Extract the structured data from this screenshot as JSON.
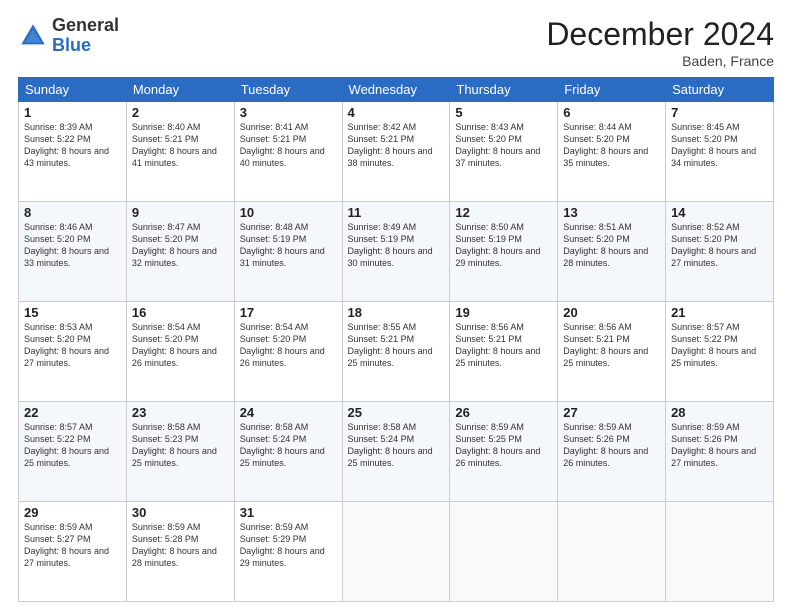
{
  "logo": {
    "general": "General",
    "blue": "Blue"
  },
  "header": {
    "month": "December 2024",
    "location": "Baden, France"
  },
  "weekdays": [
    "Sunday",
    "Monday",
    "Tuesday",
    "Wednesday",
    "Thursday",
    "Friday",
    "Saturday"
  ],
  "weeks": [
    [
      {
        "day": "1",
        "sunrise": "8:39 AM",
        "sunset": "5:22 PM",
        "daylight": "8 hours and 43 minutes."
      },
      {
        "day": "2",
        "sunrise": "8:40 AM",
        "sunset": "5:21 PM",
        "daylight": "8 hours and 41 minutes."
      },
      {
        "day": "3",
        "sunrise": "8:41 AM",
        "sunset": "5:21 PM",
        "daylight": "8 hours and 40 minutes."
      },
      {
        "day": "4",
        "sunrise": "8:42 AM",
        "sunset": "5:21 PM",
        "daylight": "8 hours and 38 minutes."
      },
      {
        "day": "5",
        "sunrise": "8:43 AM",
        "sunset": "5:20 PM",
        "daylight": "8 hours and 37 minutes."
      },
      {
        "day": "6",
        "sunrise": "8:44 AM",
        "sunset": "5:20 PM",
        "daylight": "8 hours and 35 minutes."
      },
      {
        "day": "7",
        "sunrise": "8:45 AM",
        "sunset": "5:20 PM",
        "daylight": "8 hours and 34 minutes."
      }
    ],
    [
      {
        "day": "8",
        "sunrise": "8:46 AM",
        "sunset": "5:20 PM",
        "daylight": "8 hours and 33 minutes."
      },
      {
        "day": "9",
        "sunrise": "8:47 AM",
        "sunset": "5:20 PM",
        "daylight": "8 hours and 32 minutes."
      },
      {
        "day": "10",
        "sunrise": "8:48 AM",
        "sunset": "5:19 PM",
        "daylight": "8 hours and 31 minutes."
      },
      {
        "day": "11",
        "sunrise": "8:49 AM",
        "sunset": "5:19 PM",
        "daylight": "8 hours and 30 minutes."
      },
      {
        "day": "12",
        "sunrise": "8:50 AM",
        "sunset": "5:19 PM",
        "daylight": "8 hours and 29 minutes."
      },
      {
        "day": "13",
        "sunrise": "8:51 AM",
        "sunset": "5:20 PM",
        "daylight": "8 hours and 28 minutes."
      },
      {
        "day": "14",
        "sunrise": "8:52 AM",
        "sunset": "5:20 PM",
        "daylight": "8 hours and 27 minutes."
      }
    ],
    [
      {
        "day": "15",
        "sunrise": "8:53 AM",
        "sunset": "5:20 PM",
        "daylight": "8 hours and 27 minutes."
      },
      {
        "day": "16",
        "sunrise": "8:54 AM",
        "sunset": "5:20 PM",
        "daylight": "8 hours and 26 minutes."
      },
      {
        "day": "17",
        "sunrise": "8:54 AM",
        "sunset": "5:20 PM",
        "daylight": "8 hours and 26 minutes."
      },
      {
        "day": "18",
        "sunrise": "8:55 AM",
        "sunset": "5:21 PM",
        "daylight": "8 hours and 25 minutes."
      },
      {
        "day": "19",
        "sunrise": "8:56 AM",
        "sunset": "5:21 PM",
        "daylight": "8 hours and 25 minutes."
      },
      {
        "day": "20",
        "sunrise": "8:56 AM",
        "sunset": "5:21 PM",
        "daylight": "8 hours and 25 minutes."
      },
      {
        "day": "21",
        "sunrise": "8:57 AM",
        "sunset": "5:22 PM",
        "daylight": "8 hours and 25 minutes."
      }
    ],
    [
      {
        "day": "22",
        "sunrise": "8:57 AM",
        "sunset": "5:22 PM",
        "daylight": "8 hours and 25 minutes."
      },
      {
        "day": "23",
        "sunrise": "8:58 AM",
        "sunset": "5:23 PM",
        "daylight": "8 hours and 25 minutes."
      },
      {
        "day": "24",
        "sunrise": "8:58 AM",
        "sunset": "5:24 PM",
        "daylight": "8 hours and 25 minutes."
      },
      {
        "day": "25",
        "sunrise": "8:58 AM",
        "sunset": "5:24 PM",
        "daylight": "8 hours and 25 minutes."
      },
      {
        "day": "26",
        "sunrise": "8:59 AM",
        "sunset": "5:25 PM",
        "daylight": "8 hours and 26 minutes."
      },
      {
        "day": "27",
        "sunrise": "8:59 AM",
        "sunset": "5:26 PM",
        "daylight": "8 hours and 26 minutes."
      },
      {
        "day": "28",
        "sunrise": "8:59 AM",
        "sunset": "5:26 PM",
        "daylight": "8 hours and 27 minutes."
      }
    ],
    [
      {
        "day": "29",
        "sunrise": "8:59 AM",
        "sunset": "5:27 PM",
        "daylight": "8 hours and 27 minutes."
      },
      {
        "day": "30",
        "sunrise": "8:59 AM",
        "sunset": "5:28 PM",
        "daylight": "8 hours and 28 minutes."
      },
      {
        "day": "31",
        "sunrise": "8:59 AM",
        "sunset": "5:29 PM",
        "daylight": "8 hours and 29 minutes."
      },
      null,
      null,
      null,
      null
    ]
  ],
  "cell_labels": {
    "sunrise": "Sunrise: ",
    "sunset": "Sunset: ",
    "daylight": "Daylight: "
  }
}
